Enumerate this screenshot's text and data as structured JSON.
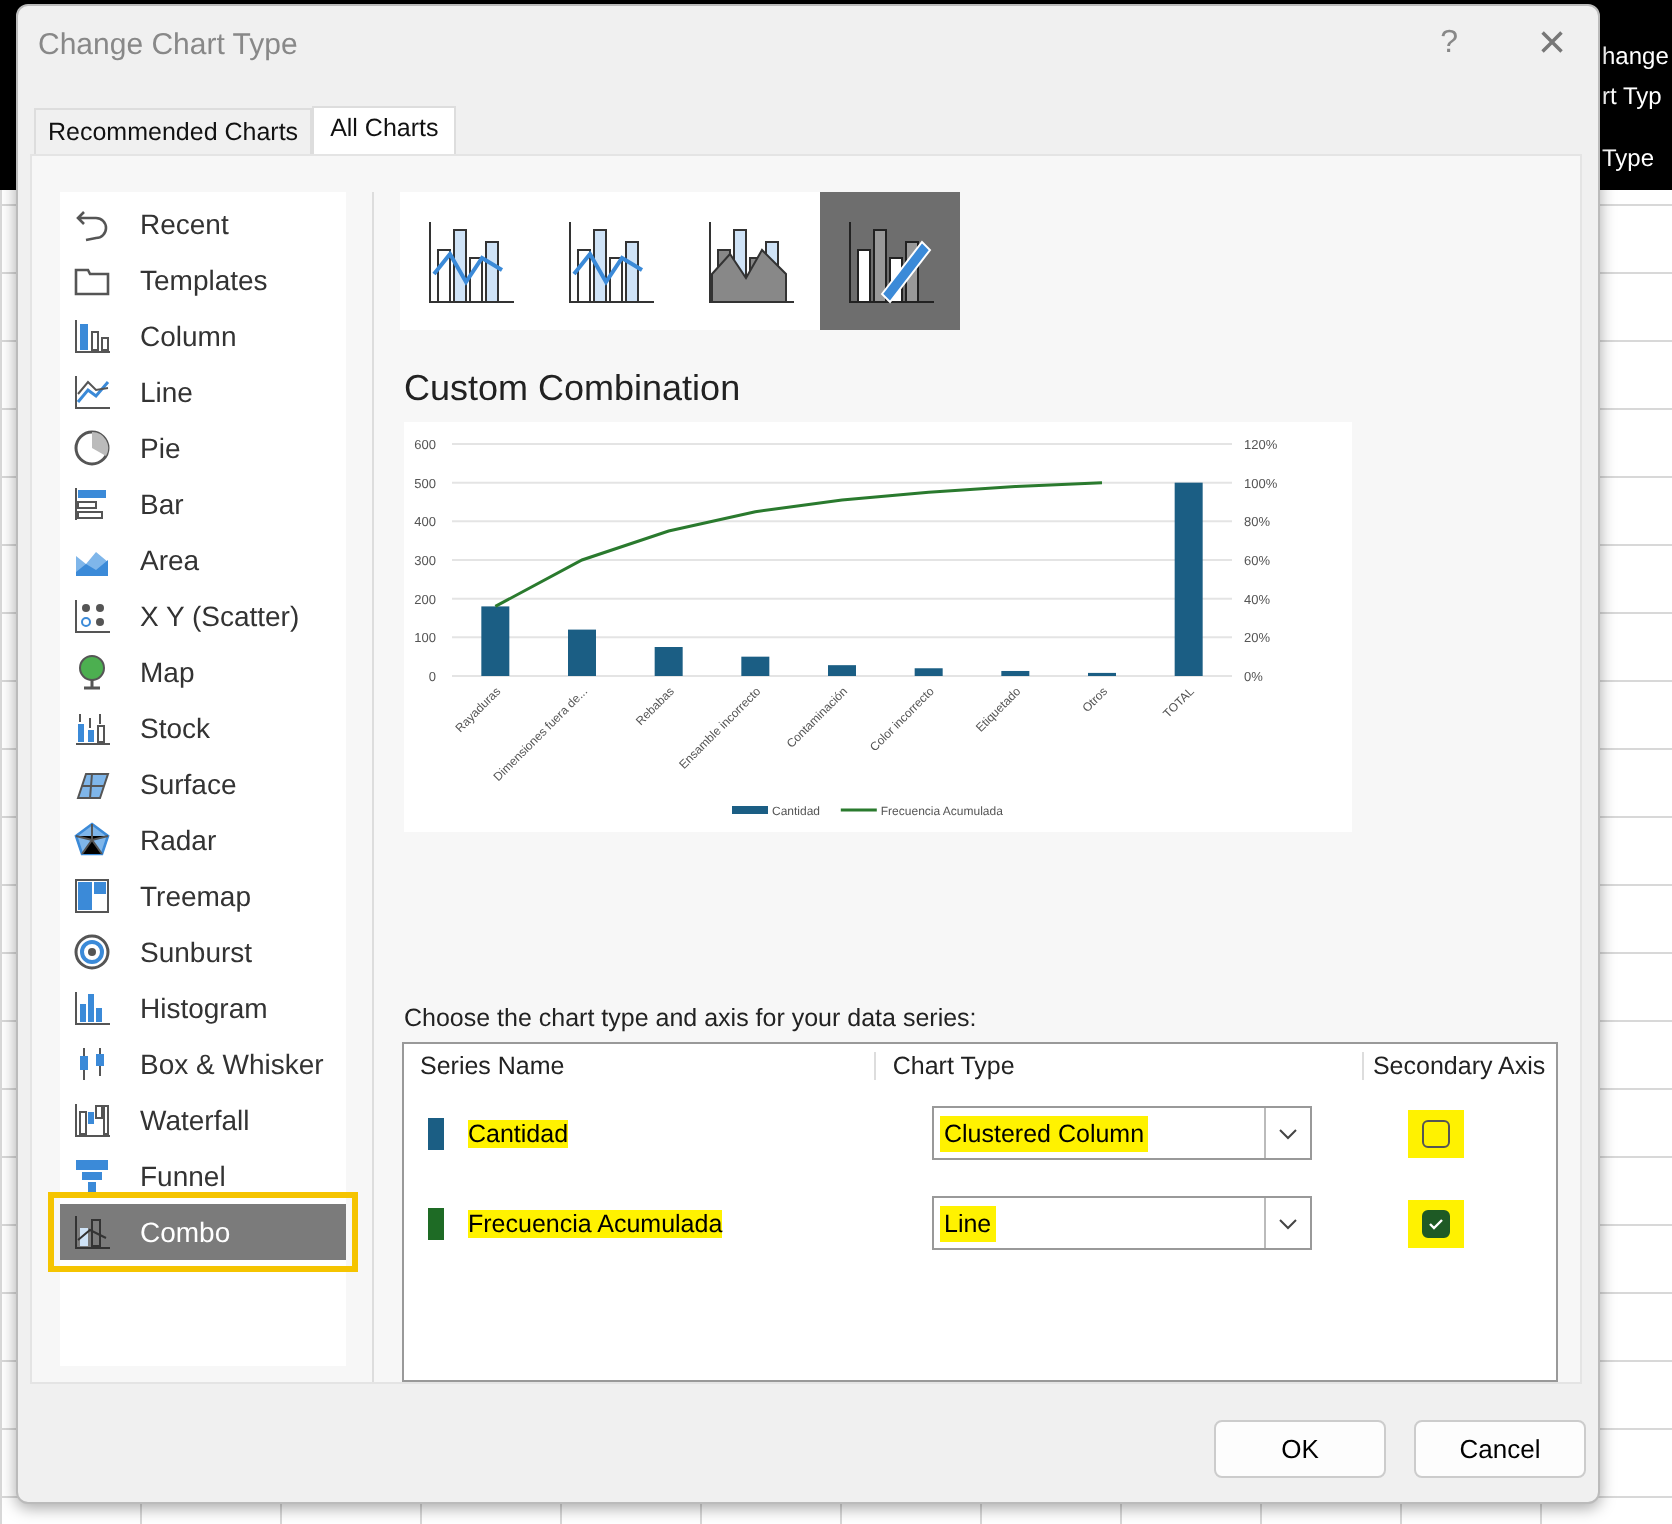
{
  "background": {
    "ribbon_texts": [
      "hange",
      "rt Typ",
      "Type"
    ]
  },
  "window": {
    "title": "Change Chart Type",
    "help": "?",
    "close": "×"
  },
  "tabs": [
    {
      "label": "Recommended Charts",
      "selected": false
    },
    {
      "label": "All Charts",
      "selected": true
    }
  ],
  "sidebar": {
    "items": [
      {
        "label": "Recent",
        "selected": false
      },
      {
        "label": "Templates",
        "selected": false
      },
      {
        "label": "Column",
        "selected": false
      },
      {
        "label": "Line",
        "selected": false
      },
      {
        "label": "Pie",
        "selected": false
      },
      {
        "label": "Bar",
        "selected": false
      },
      {
        "label": "Area",
        "selected": false
      },
      {
        "label": "X Y (Scatter)",
        "selected": false
      },
      {
        "label": "Map",
        "selected": false
      },
      {
        "label": "Stock",
        "selected": false
      },
      {
        "label": "Surface",
        "selected": false
      },
      {
        "label": "Radar",
        "selected": false
      },
      {
        "label": "Treemap",
        "selected": false
      },
      {
        "label": "Sunburst",
        "selected": false
      },
      {
        "label": "Histogram",
        "selected": false
      },
      {
        "label": "Box & Whisker",
        "selected": false
      },
      {
        "label": "Waterfall",
        "selected": false
      },
      {
        "label": "Funnel",
        "selected": false
      },
      {
        "label": "Combo",
        "selected": true
      }
    ]
  },
  "subtypes": [
    {
      "selected": false
    },
    {
      "selected": false
    },
    {
      "selected": false
    },
    {
      "selected": true
    }
  ],
  "heading": "Custom Combination",
  "preview": {
    "chart_data": {
      "type": "bar",
      "categories": [
        "Rayaduras",
        "Dimensiones fuera de...",
        "Rebabas",
        "Ensamble incorrecto",
        "Contaminación",
        "Color incorrecto",
        "Etiquetado",
        "Otros",
        "TOTAL"
      ],
      "ylim": [
        0,
        600
      ],
      "stacked": false,
      "grid": true,
      "legend": "bottom",
      "y2lim": [
        0,
        120
      ],
      "y2ticks": [
        {
          "value": 0,
          "label": "0%"
        },
        {
          "value": 20,
          "label": "20%"
        },
        {
          "value": 40,
          "label": "40%"
        },
        {
          "value": 60,
          "label": "60%"
        },
        {
          "value": 80,
          "label": "80%"
        },
        {
          "value": 100,
          "label": "100%"
        },
        {
          "value": 120,
          "label": "120%"
        }
      ],
      "yticks": [
        0,
        100,
        200,
        300,
        400,
        500,
        600
      ],
      "series": [
        {
          "name": "Cantidad",
          "color": "#1b5e84",
          "values": [
            180,
            120,
            75,
            50,
            28,
            20,
            13,
            8,
            500
          ]
        },
        {
          "name": "Frecuencia Acumulada",
          "color": "#2a7a2e",
          "type": "line",
          "axis": "y2",
          "values": [
            36,
            60,
            75,
            85,
            91,
            95,
            98,
            100,
            null
          ]
        }
      ]
    }
  },
  "series_prompt": "Choose the chart type and axis for your data series:",
  "series_table": {
    "columns": [
      "Series Name",
      "Chart Type",
      "Secondary Axis"
    ],
    "rows": [
      {
        "color": "#1b5e84",
        "name": "Cantidad",
        "chart_type": "Clustered Column",
        "secondary_axis": false
      },
      {
        "color": "#1e6b25",
        "name": "Frecuencia Acumulada",
        "chart_type": "Line",
        "secondary_axis": true
      }
    ]
  },
  "buttons": [
    "OK",
    "Cancel"
  ]
}
